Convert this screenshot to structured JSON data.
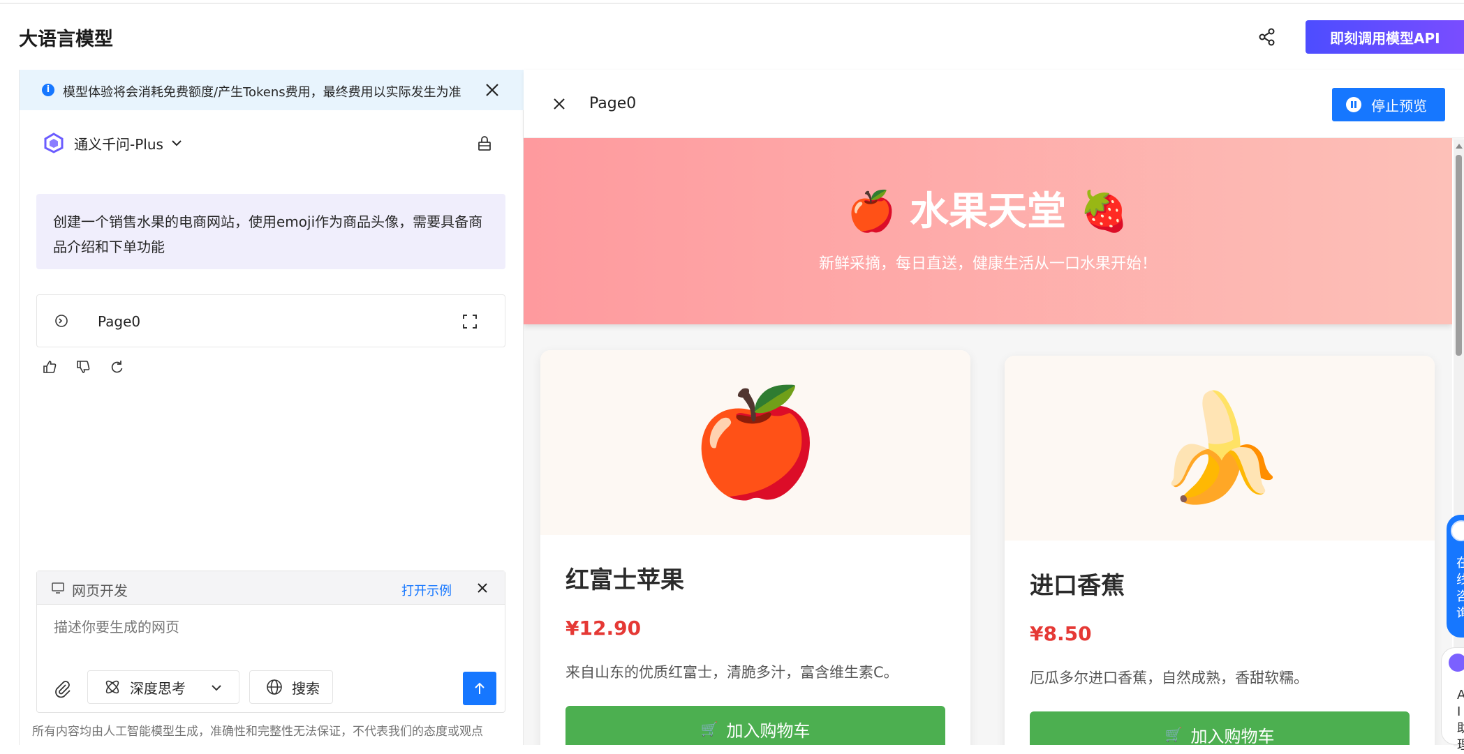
{
  "header": {
    "title": "大语言模型",
    "share_icon": "share-icon",
    "api_button": "即刻调用模型API"
  },
  "notice": {
    "text": "模型体验将会消耗免费额度/产生Tokens费用，最终费用以实际发生为准"
  },
  "model": {
    "name": "通义千问-Plus"
  },
  "chat": {
    "prompt": "创建一个销售水果的电商网站，使用emoji作为商品头像，需要具备商品介绍和下单功能",
    "page_card_label": "Page0"
  },
  "composer": {
    "mode_label": "网页开发",
    "example_link": "打开示例",
    "placeholder": "描述你要生成的网页",
    "think_label": "深度思考",
    "search_label": "搜索"
  },
  "disclaimer": "所有内容均由人工智能模型生成，准确性和完整性无法保证，不代表我们的态度或观点",
  "preview": {
    "title": "Page0",
    "stop_button": "停止预览",
    "hero_title": "🍎 水果天堂 🍓",
    "hero_subtitle": "新鲜采摘，每日直送，健康生活从一口水果开始！",
    "products": [
      {
        "emoji": "🍎",
        "name": "红富士苹果",
        "price": "¥12.90",
        "desc": "来自山东的优质红富士，清脆多汁，富含维生素C。",
        "cart_label": "加入购物车"
      },
      {
        "emoji": "🍌",
        "name": "进口香蕉",
        "price": "¥8.50",
        "desc": "厄瓜多尔进口香蕉，自然成熟，香甜软糯。",
        "cart_label": "加入购物车"
      }
    ]
  },
  "floating": {
    "consult_text": "在线咨询",
    "ai_text": "AI助理"
  },
  "colors": {
    "accent": "#1677ff",
    "api_gradient_start": "#4d4dff",
    "api_gradient_end": "#7c4dff",
    "hero_start": "#fe9a9e",
    "hero_end": "#fdc0b8",
    "cart_green": "#4caf50",
    "price_red": "#e53935"
  }
}
